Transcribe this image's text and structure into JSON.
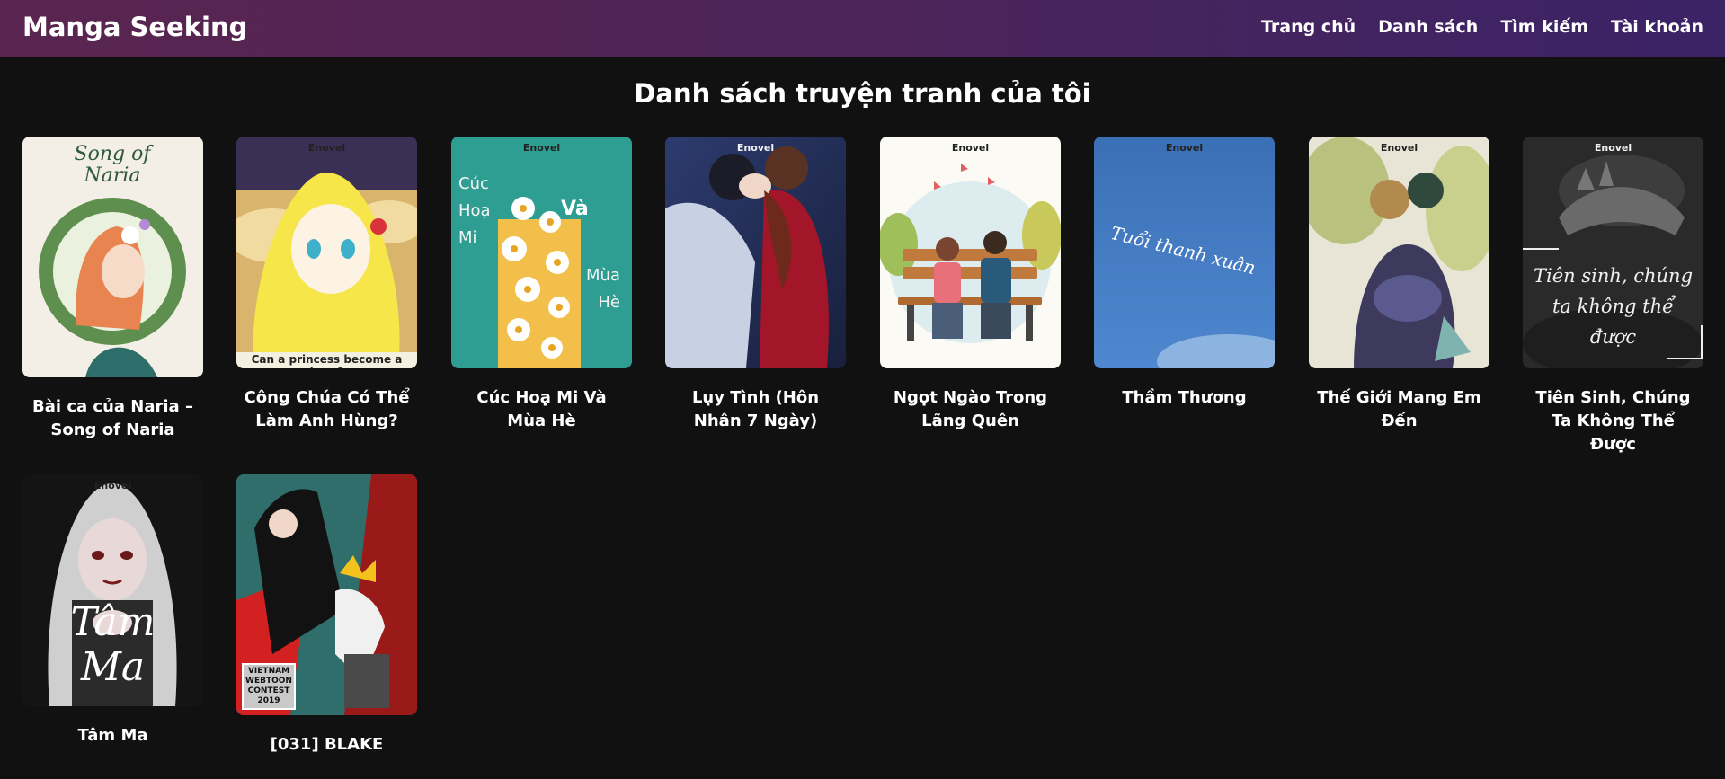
{
  "site": {
    "brand": "Manga Seeking",
    "nav": [
      "Trang chủ",
      "Danh sách",
      "Tìm kiếm",
      "Tài khoản"
    ]
  },
  "page": {
    "title": "Danh sách truyện tranh của tôi"
  },
  "cover_texts": {
    "naria": "Song of\nNaria",
    "princess": "Can a princess become a hero?",
    "cuc_hoa_mi_1": "Cúc\nHoạ\nMi",
    "cuc_hoa_mi_2": "Và",
    "cuc_hoa_mi_3": "Mùa\nHè",
    "tham_thuong": "Tuổi thanh xuân",
    "tien_sinh": "Tiên sinh, chúng\nta không thể\nđược",
    "tam_ma": "Tâm\nMa",
    "blake_badge": "VIETNAM\nWEBTOON\nCONTEST\n2019",
    "enovel": "Enovel"
  },
  "colors": {
    "background": "#111111",
    "nav_gradient_start": "#5a2550",
    "nav_gradient_end": "#3b2366"
  },
  "comics": [
    {
      "title": "Bài ca của Naria – Song of Naria",
      "cover": "naria"
    },
    {
      "title": "Công Chúa Có Thể Làm Anh Hùng?",
      "cover": "princess"
    },
    {
      "title": "Cúc Hoạ Mi Và Mùa Hè",
      "cover": "daisy"
    },
    {
      "title": "Lụy Tình (Hôn Nhân 7 Ngày)",
      "cover": "couple"
    },
    {
      "title": "Ngọt Ngào Trong Lãng Quên",
      "cover": "bench"
    },
    {
      "title": "Thầm Thương",
      "cover": "blue"
    },
    {
      "title": "Thế Giới Mang Em Đến",
      "cover": "fantasy"
    },
    {
      "title": "Tiên Sinh, Chúng Ta Không Thể Được",
      "cover": "dark-hands"
    },
    {
      "title": "Tâm Ma",
      "cover": "tam-ma"
    },
    {
      "title": "[031] BLAKE",
      "cover": "blake"
    }
  ]
}
